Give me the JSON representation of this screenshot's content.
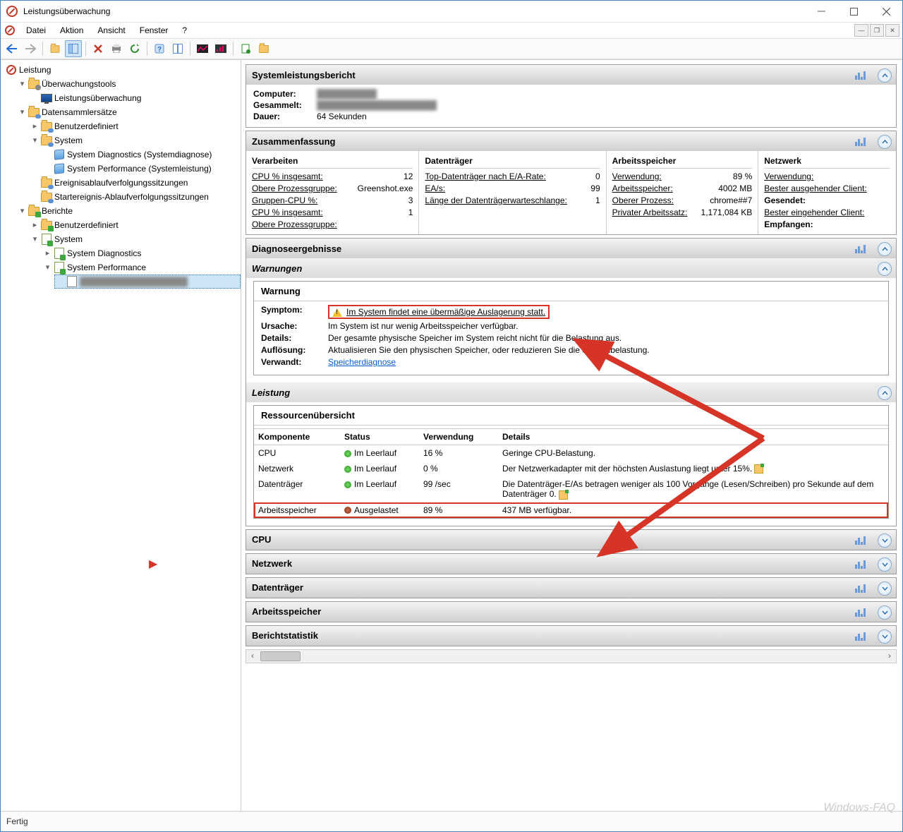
{
  "window": {
    "title": "Leistungsüberwachung"
  },
  "menubar": {
    "items": [
      "Datei",
      "Aktion",
      "Ansicht",
      "Fenster",
      "?"
    ]
  },
  "tree": {
    "root": "Leistung",
    "monitoring_tools": "Überwachungstools",
    "perf_monitor": "Leistungsüberwachung",
    "collector_sets": "Datensammlersätze",
    "user_defined": "Benutzerdefiniert",
    "system": "System",
    "sys_diag": "System Diagnostics (Systemdiagnose)",
    "sys_perf": "System Performance (Systemleistung)",
    "event_trace": "Ereignisablaufverfolgungssitzungen",
    "startup_trace": "Startereignis-Ablaufverfolgungssitzungen",
    "reports": "Berichte",
    "rep_user": "Benutzerdefiniert",
    "rep_system": "System",
    "rep_diag": "System Diagnostics",
    "rep_perf": "System Performance",
    "selected_report": "██████████████████"
  },
  "report": {
    "header": "Systemleistungsbericht",
    "computer_k": "Computer:",
    "computer_v": "██████████",
    "collected_k": "Gesammelt:",
    "collected_v": "████████████████████",
    "duration_k": "Dauer:",
    "duration_v": "64 Sekunden"
  },
  "summary": {
    "header": "Zusammenfassung",
    "cols": {
      "proc": {
        "h": "Verarbeiten",
        "r1k": "CPU % insgesamt:",
        "r1v": "12",
        "r2k": "Obere Prozessgruppe:",
        "r2v": "Greenshot.exe",
        "r3k": "Gruppen-CPU %:",
        "r3v": "3",
        "r4k": "CPU % insgesamt:",
        "r4v": "1",
        "r5k": "Obere Prozessgruppe:"
      },
      "disk": {
        "h": "Datenträger",
        "r1k": "Top-Datenträger nach E/A-Rate:",
        "r1v": "0",
        "r2k": "EA/s:",
        "r2v": "99",
        "r3k": "Länge der Datenträgerwarteschlange:",
        "r3v": "1"
      },
      "mem": {
        "h": "Arbeitsspeicher",
        "r1k": "Verwendung:",
        "r1v": "89 %",
        "r2k": "Arbeitsspeicher:",
        "r2v": "4002 MB",
        "r3k": "Oberer Prozess:",
        "r3v": "chrome##7",
        "r4k": "Privater Arbeitssatz:",
        "r4v": "1,171,084 KB"
      },
      "net": {
        "h": "Netzwerk",
        "r1k": "Verwendung:",
        "r2k": "Bester ausgehender Client:",
        "r3k": "Gesendet:",
        "r4k": "Bester eingehender Client:",
        "r5k": "Empfangen:"
      }
    }
  },
  "diag": {
    "header": "Diagnoseergebnisse",
    "warnings_h": "Warnungen",
    "warn_h": "Warnung",
    "symptom_k": "Symptom:",
    "symptom_v": "Im System findet eine übermäßige Auslagerung statt.",
    "cause_k": "Ursache:",
    "cause_v": "Im System ist nur wenig Arbeitsspeicher verfügbar.",
    "details_k": "Details:",
    "details_v": "Der gesamte physische Speicher im System reicht nicht für die Belastung aus.",
    "resolution_k": "Auflösung:",
    "resolution_v": "Aktualisieren Sie den physischen Speicher, oder reduzieren Sie die Systembelastung.",
    "related_k": "Verwandt:",
    "related_v": "Speicherdiagnose"
  },
  "perf": {
    "header": "Leistung",
    "res_h": "Ressourcenübersicht",
    "th": {
      "comp": "Komponente",
      "status": "Status",
      "usage": "Verwendung",
      "details": "Details"
    },
    "rows": [
      {
        "comp": "CPU",
        "status_color": "green",
        "status": "Im Leerlauf",
        "usage": "16 %",
        "details": "Geringe CPU-Belastung."
      },
      {
        "comp": "Netzwerk",
        "status_color": "green",
        "status": "Im Leerlauf",
        "usage": "0 %",
        "details": "Der Netzwerkadapter mit der höchsten Auslastung liegt unter 15%."
      },
      {
        "comp": "Datenträger",
        "status_color": "green",
        "status": "Im Leerlauf",
        "usage": "99 /sec",
        "details": "Die Datenträger-E/As betragen weniger als 100 Vorgänge (Lesen/Schreiben) pro Sekunde auf dem Datenträger 0."
      },
      {
        "comp": "Arbeitsspeicher",
        "status_color": "red",
        "status": "Ausgelastet",
        "usage": "89 %",
        "details": "437 MB verfügbar."
      }
    ]
  },
  "sections": {
    "cpu": "CPU",
    "net": "Netzwerk",
    "disk": "Datenträger",
    "mem": "Arbeitsspeicher",
    "stats": "Berichtstatistik"
  },
  "status": {
    "ready": "Fertig"
  },
  "watermark": "Windows-FAQ"
}
